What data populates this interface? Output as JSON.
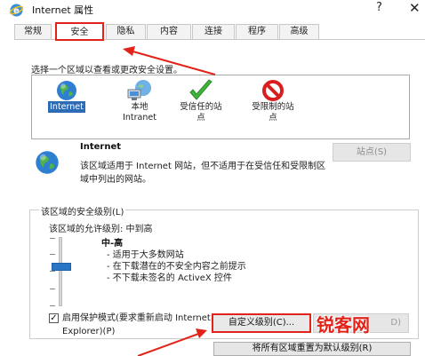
{
  "window": {
    "title": "Internet 属性",
    "help": "?",
    "close": "✕"
  },
  "tabs": [
    {
      "label": "常规"
    },
    {
      "label": "安全"
    },
    {
      "label": "隐私"
    },
    {
      "label": "内容"
    },
    {
      "label": "连接"
    },
    {
      "label": "程序"
    },
    {
      "label": "高级"
    }
  ],
  "active_tab": "安全",
  "zones": {
    "prompt": "选择一个区域以查看或更改安全设置。",
    "items": [
      {
        "label": "Internet",
        "icon": "globe-icon",
        "selected": true
      },
      {
        "label": "本地\nIntranet",
        "icon": "intranet-icon"
      },
      {
        "label": "受信任的站\n点",
        "icon": "checkmark-icon"
      },
      {
        "label": "受限制的站\n点",
        "icon": "restricted-icon"
      }
    ]
  },
  "description": {
    "title": "Internet",
    "text": "该区域适用于 Internet 网站，但不适用于在受信任和受限制区域中列出的网站。",
    "sites_button": "站点(S)"
  },
  "security_level": {
    "group_title": "该区域的安全级别(L)",
    "allowed_levels": "该区域的允许级别: 中到高",
    "level_name": "中-高",
    "level_points": [
      "- 适用于大多数网站",
      "- 在下载潜在的不安全内容之前提示",
      "- 不下载未签名的 ActiveX 控件"
    ],
    "slider_value": "中-高",
    "protected_mode_checked": true,
    "protected_mode_label": "启用保护模式(要求重新启动 Internet Explorer)(P)",
    "custom_button": "自定义级别(C)...",
    "default_button": "D)"
  },
  "reset_button": "将所有区域重置为默认级别(R)",
  "watermark": "锐客网",
  "colors": {
    "highlight": "#e2231a",
    "selection": "#2d6bb5",
    "slider": "#2a76c6"
  }
}
